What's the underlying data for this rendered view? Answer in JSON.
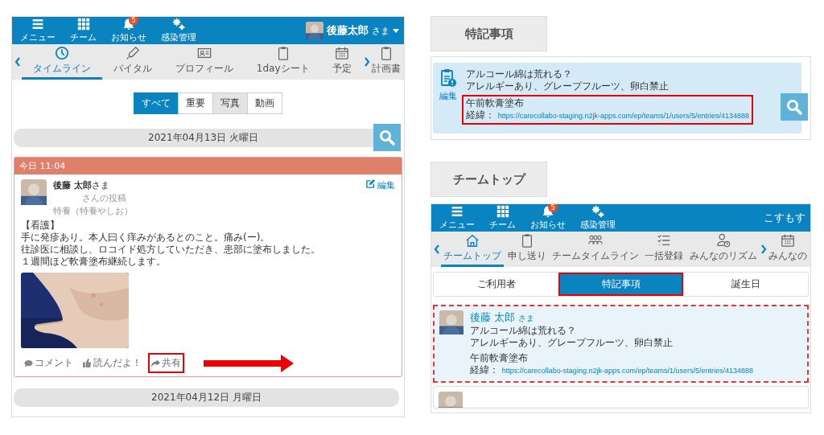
{
  "timeline_screen": {
    "header": {
      "nav_buttons": [
        {
          "label": "メニュー",
          "kind": "menu"
        },
        {
          "label": "チーム",
          "kind": "grid"
        },
        {
          "label": "お知らせ",
          "kind": "bell",
          "badge": "5"
        },
        {
          "label": "感染管理",
          "kind": "gears"
        }
      ],
      "user_name": "後藤太郎",
      "user_suffix": "さま"
    },
    "tabs": [
      {
        "label": "タイムライン",
        "kind": "clock",
        "selected": true
      },
      {
        "label": "バイタル",
        "kind": "thermometer",
        "selected": false
      },
      {
        "label": "プロフィール",
        "kind": "idcard",
        "selected": false
      },
      {
        "label": "1dayシート",
        "kind": "clipboard",
        "selected": false
      },
      {
        "label": "予定",
        "kind": "calendar",
        "selected": false
      },
      {
        "label": "計画書",
        "kind": "clipboard",
        "selected": false
      }
    ],
    "filters": [
      {
        "label": "すべて",
        "selected": true,
        "highlighted": false
      },
      {
        "label": "重要",
        "selected": false,
        "highlighted": false
      },
      {
        "label": "写真",
        "selected": false,
        "highlighted": true
      },
      {
        "label": "動画",
        "selected": false,
        "highlighted": false
      }
    ],
    "date_header": "2021年04月13日 火曜日",
    "post": {
      "time": "今日 11:04",
      "author": "後藤 太郎",
      "author_suffix": "さま",
      "posted_by": "さんの投稿",
      "facility": "特養（特養やしお）",
      "edit": "編集",
      "body": [
        "【看護】",
        "手に発疹あり。本人曰く痒みがあるとのこと。痛み(ー)。",
        "往診医に相談し、ロコイド処方していただき、患部に塗布しました。",
        "１週間ほど軟膏塗布継続します。"
      ],
      "actions": [
        {
          "label": "コメント",
          "kind": "comment",
          "highlighted": false
        },
        {
          "label": "読んだよ！",
          "kind": "like",
          "highlighted": false
        },
        {
          "label": "共有",
          "kind": "share",
          "highlighted": true
        }
      ]
    },
    "next_date_header": "2021年04月12日 月曜日"
  },
  "notes_label": "特記事項",
  "notes_panel": {
    "edit": "編集",
    "lines": [
      "アルコール綿は荒れる？",
      "アレルギーあり、グレープフルーツ、卵白禁止"
    ],
    "memo": "午前軟膏塗布",
    "history_label": "経緯：",
    "history_link": "https://carecollabo-staging.n2jk-apps.com/ep/teams/1/users/5/entries/4134888",
    "highlighted": true
  },
  "team_label": "チームトップ",
  "team_screen": {
    "header": {
      "nav_buttons": [
        {
          "label": "メニュー",
          "kind": "menu"
        },
        {
          "label": "チーム",
          "kind": "grid"
        },
        {
          "label": "お知らせ",
          "kind": "bell",
          "badge": "5"
        },
        {
          "label": "感染管理",
          "kind": "gears"
        }
      ],
      "team_name": "こすもす"
    },
    "tabs": [
      {
        "label": "チームトップ",
        "kind": "home",
        "selected": true
      },
      {
        "label": "申し送り",
        "kind": "clipboard",
        "selected": false
      },
      {
        "label": "チームタイムライン",
        "kind": "people",
        "selected": false
      },
      {
        "label": "一括登録",
        "kind": "checklist",
        "selected": false
      },
      {
        "label": "みんなのリズム",
        "kind": "personclock",
        "selected": false
      },
      {
        "label": "みんなの",
        "kind": "calendar",
        "selected": false
      }
    ],
    "segments": [
      {
        "label": "ご利用者",
        "selected": false,
        "highlighted": false
      },
      {
        "label": "特記事項",
        "selected": true,
        "highlighted": true
      },
      {
        "label": "誕生日",
        "selected": false,
        "highlighted": false
      }
    ],
    "cards": [
      {
        "kind": "full",
        "name": "後藤 太郎",
        "suffix": "さま",
        "lines": [
          "アルコール綿は荒れる？",
          "アレルギーあり、グレープフルーツ、卵白禁止"
        ],
        "memo": "午前軟膏塗布",
        "history_label": "経緯：",
        "history_link": "https://carecollabo-staging.n2jk-apps.com/ep/teams/1/users/5/entries/4134888",
        "highlighted": true
      },
      {
        "kind": "cut"
      }
    ]
  }
}
